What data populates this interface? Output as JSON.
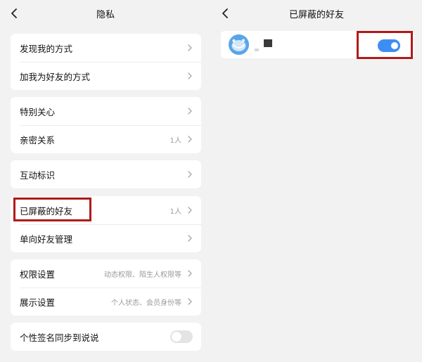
{
  "left": {
    "title": "隐私",
    "groups": [
      [
        {
          "label": "发现我的方式",
          "hint": ""
        },
        {
          "label": "加我为好友的方式",
          "hint": ""
        }
      ],
      [
        {
          "label": "特别关心",
          "hint": ""
        },
        {
          "label": "亲密关系",
          "hint": "1人"
        }
      ],
      [
        {
          "label": "互动标识",
          "hint": ""
        }
      ],
      [
        {
          "label": "已屏蔽的好友",
          "hint": "1人"
        },
        {
          "label": "单向好友管理",
          "hint": ""
        }
      ],
      [
        {
          "label": "权限设置",
          "hint": "动态权限、陌生人权限等"
        },
        {
          "label": "展示设置",
          "hint": "个人状态、会员身份等"
        }
      ],
      [
        {
          "label": "个性签名同步到说说",
          "toggle": "off"
        }
      ]
    ]
  },
  "right": {
    "title": "已屏蔽的好友",
    "friend": {
      "toggle": "on"
    }
  },
  "colors": {
    "background": "#f2f2f2",
    "card": "#ffffff",
    "accent_toggle_on": "#3d8df5",
    "toggle_off": "#e4e4e4",
    "highlight": "#b11a1a",
    "hint_text": "#9a9a9a",
    "avatar": "#5aa5e6"
  },
  "icons": {
    "back": "chevron-left-icon",
    "row_arrow": "chevron-right-icon",
    "avatar": "avatar-icon"
  }
}
